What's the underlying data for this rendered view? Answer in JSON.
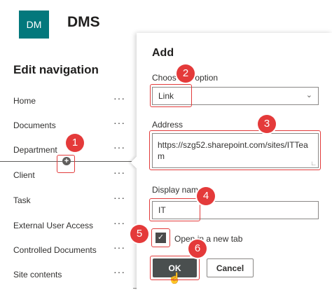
{
  "header": {
    "logo_text": "DM",
    "site_title": "DMS",
    "logo_color": "#03787c"
  },
  "nav": {
    "title": "Edit navigation",
    "more_label": "···",
    "items": [
      {
        "label": "Home"
      },
      {
        "label": "Documents"
      },
      {
        "label": "Department"
      },
      {
        "label": "Client"
      },
      {
        "label": "Task"
      },
      {
        "label": "External User Access"
      },
      {
        "label": "Controlled Documents"
      },
      {
        "label": "Site contents"
      }
    ],
    "add_icon": "plus-circle-icon"
  },
  "panel": {
    "title": "Add",
    "choose_label": "Choose an option",
    "choose_value": "Link",
    "address_label": "Address",
    "address_value": "https://szg52.sharepoint.com/sites/ITTeam",
    "display_label": "Display name",
    "display_value": "IT",
    "checkbox_label": "Open in a new tab",
    "checkbox_checked": true,
    "ok_label": "OK",
    "cancel_label": "Cancel"
  },
  "annotations": {
    "color": "#e23b3b",
    "steps": [
      "1",
      "2",
      "3",
      "4",
      "5",
      "6"
    ]
  }
}
